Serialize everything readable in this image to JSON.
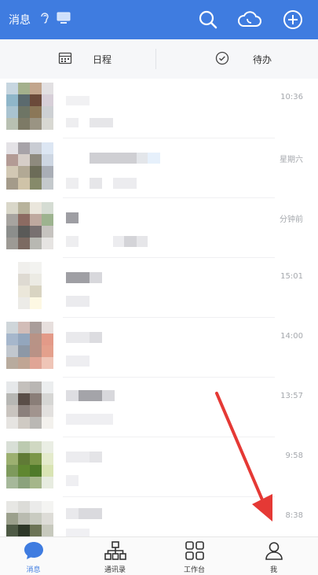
{
  "header": {
    "title": "消息",
    "ear_icon": "ear-icon",
    "pc_icon": "desktop-icon",
    "actions": [
      "search-icon",
      "cloud-call-icon",
      "add-icon"
    ],
    "bg": "#3f7ce0"
  },
  "quick": {
    "schedule_label": "日程",
    "todo_label": "待办"
  },
  "messages": [
    {
      "time": "10:36"
    },
    {
      "time": "星期六"
    },
    {
      "time": "分钟前"
    },
    {
      "time": "15:01"
    },
    {
      "time": "14:00"
    },
    {
      "time": "13:57"
    },
    {
      "time": "9:58"
    },
    {
      "time": "8:38"
    }
  ],
  "tabs": [
    {
      "label": "消息",
      "icon": "chat-bubble-icon",
      "active": true
    },
    {
      "label": "通讯录",
      "icon": "org-chart-icon",
      "active": false
    },
    {
      "label": "工作台",
      "icon": "grid-icon",
      "active": false
    },
    {
      "label": "我",
      "icon": "person-icon",
      "active": false
    }
  ],
  "annotation": {
    "color": "#e53935"
  }
}
